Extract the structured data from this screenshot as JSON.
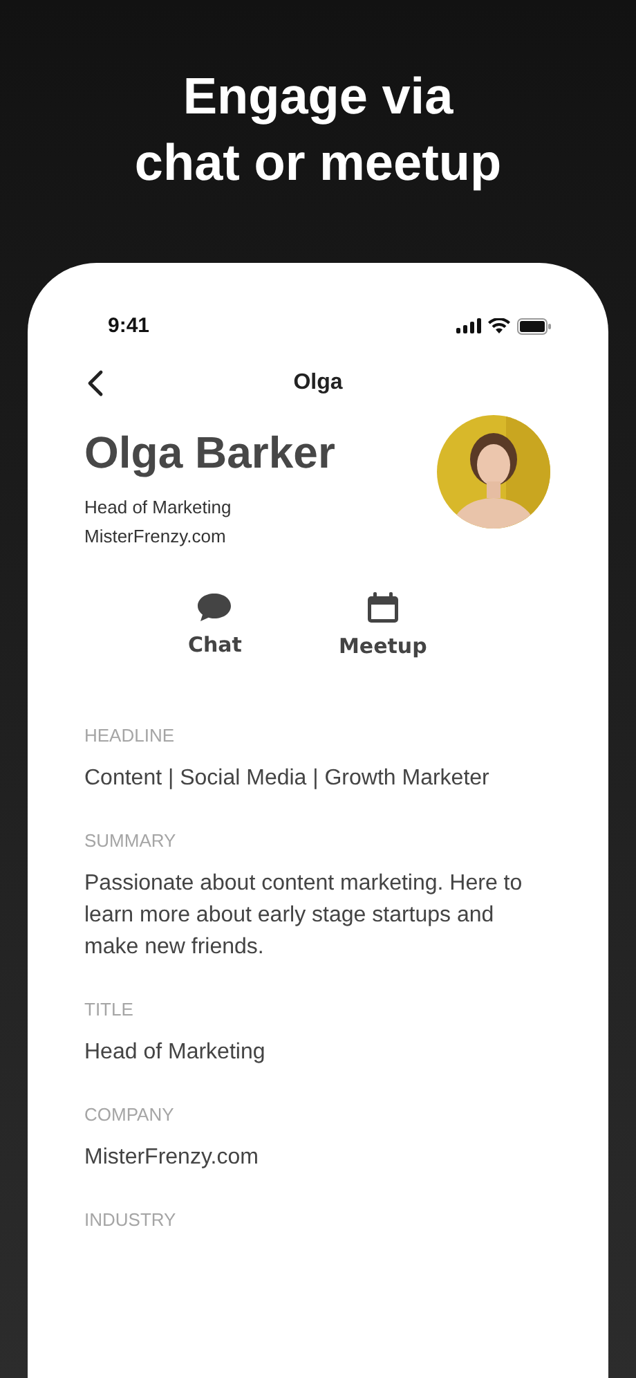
{
  "promo": {
    "title_lines": [
      "Engage via",
      "chat or meetup"
    ]
  },
  "status_bar": {
    "time": "9:41"
  },
  "nav": {
    "title": "Olga"
  },
  "profile": {
    "name": "Olga Barker",
    "role": "Head of Marketing",
    "company": "MisterFrenzy.com"
  },
  "actions": [
    {
      "kind": "chat",
      "label": "Chat"
    },
    {
      "kind": "meetup",
      "label": "Meetup"
    }
  ],
  "fields": [
    {
      "label": "HEADLINE",
      "value": "Content | Social Media | Growth Marketer"
    },
    {
      "label": "SUMMARY",
      "value": "Passionate about content marketing. Here to learn more about early stage startups and make new friends."
    },
    {
      "label": "TITLE",
      "value": "Head of Marketing"
    },
    {
      "label": "COMPANY",
      "value": "MisterFrenzy.com"
    },
    {
      "label": "INDUSTRY"
    }
  ]
}
